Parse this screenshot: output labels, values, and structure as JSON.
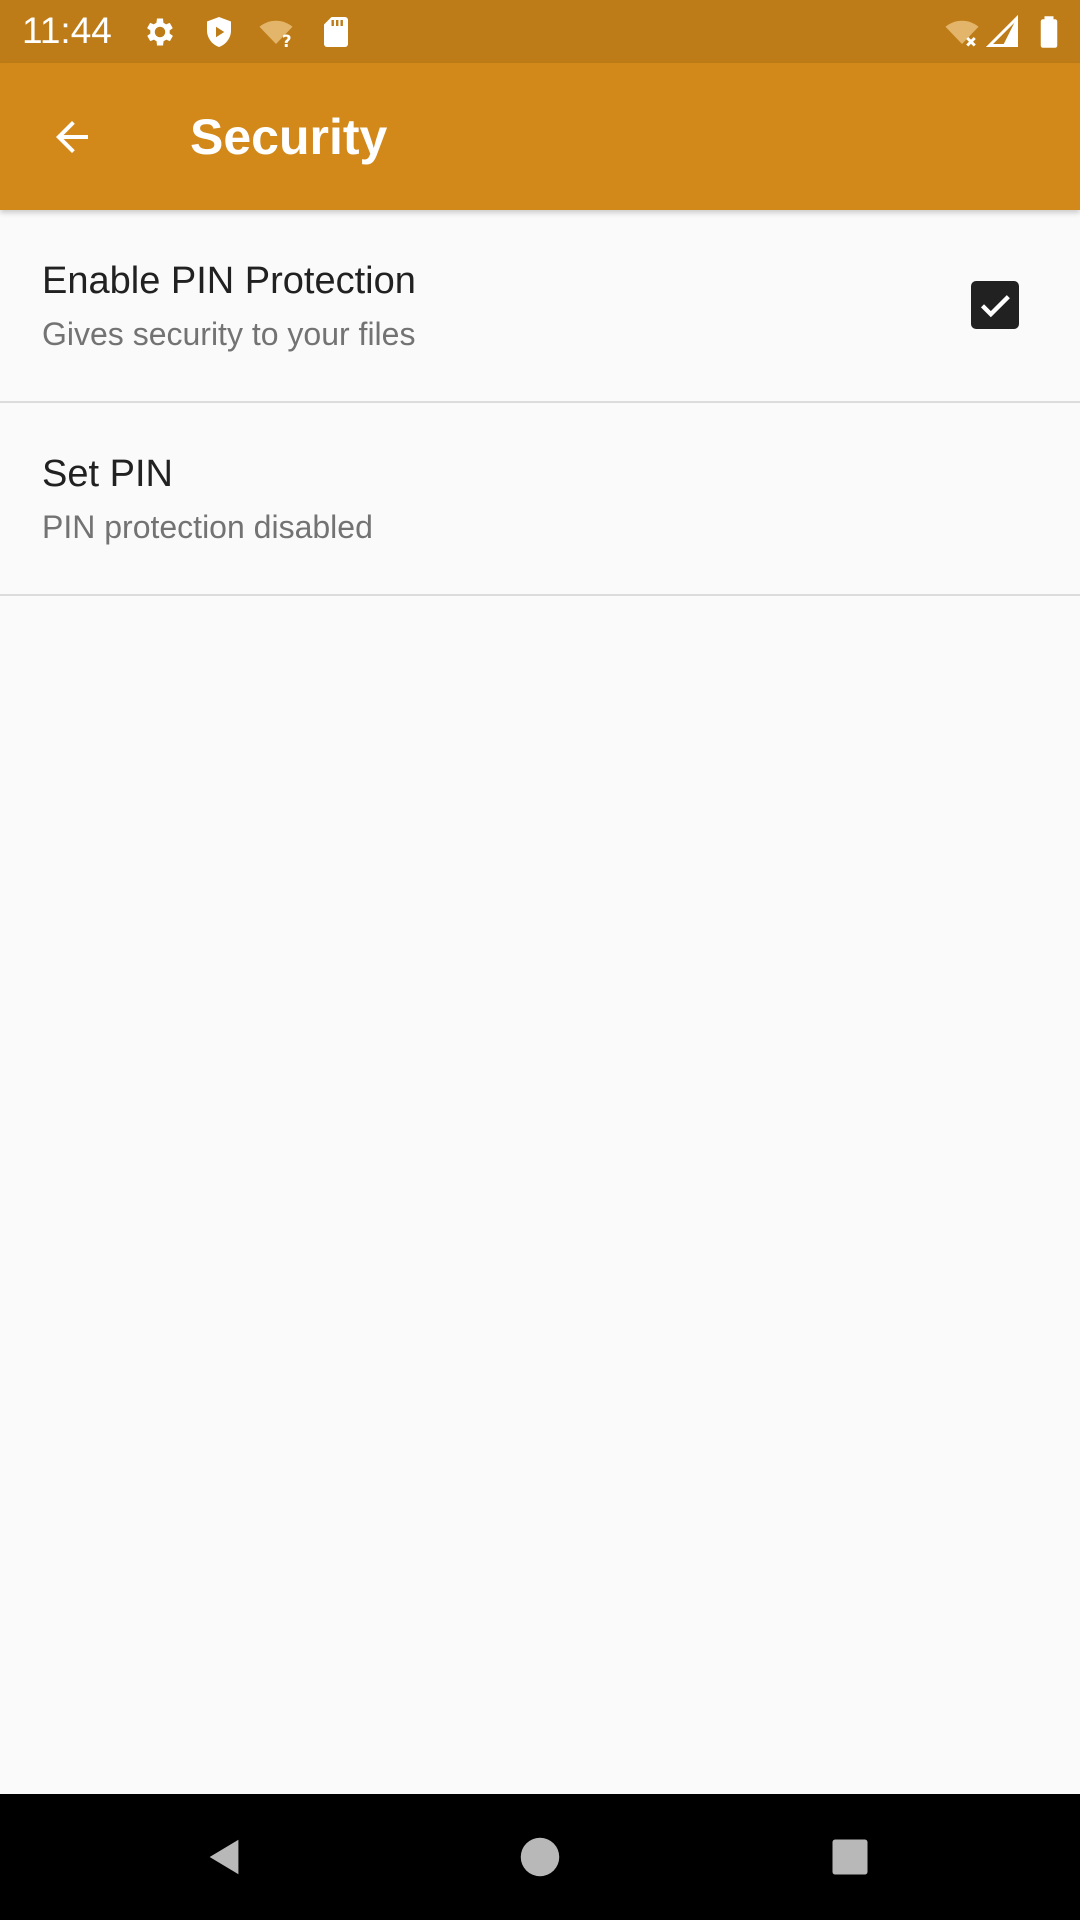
{
  "status_bar": {
    "time": "11:44",
    "icons": [
      "gear-icon",
      "shield-icon",
      "wifi-question-icon",
      "sd-card-icon",
      "wifi-x-icon",
      "signal-icon",
      "battery-icon"
    ],
    "background": "#bd7c17"
  },
  "app_bar": {
    "title": "Security",
    "back_icon": "arrow-back-icon",
    "background": "#d3891a"
  },
  "preferences": [
    {
      "title": "Enable PIN Protection",
      "summary": "Gives security to your files",
      "checked": true
    },
    {
      "title": "Set PIN",
      "summary": "PIN protection disabled"
    }
  ],
  "nav_bar": {
    "icons": [
      "back-triangle-icon",
      "home-circle-icon",
      "recents-square-icon"
    ]
  }
}
